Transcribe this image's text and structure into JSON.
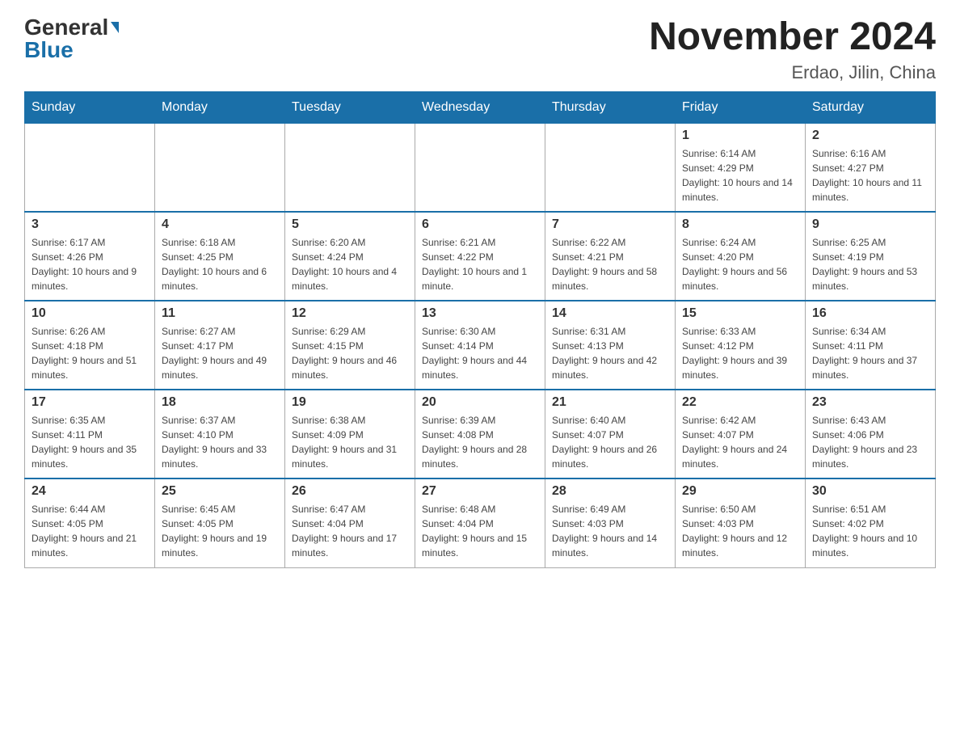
{
  "header": {
    "logo_general": "General",
    "logo_blue": "Blue",
    "month_title": "November 2024",
    "location": "Erdao, Jilin, China"
  },
  "days_of_week": [
    "Sunday",
    "Monday",
    "Tuesday",
    "Wednesday",
    "Thursday",
    "Friday",
    "Saturday"
  ],
  "weeks": [
    [
      {
        "day": "",
        "info": ""
      },
      {
        "day": "",
        "info": ""
      },
      {
        "day": "",
        "info": ""
      },
      {
        "day": "",
        "info": ""
      },
      {
        "day": "",
        "info": ""
      },
      {
        "day": "1",
        "info": "Sunrise: 6:14 AM\nSunset: 4:29 PM\nDaylight: 10 hours and 14 minutes."
      },
      {
        "day": "2",
        "info": "Sunrise: 6:16 AM\nSunset: 4:27 PM\nDaylight: 10 hours and 11 minutes."
      }
    ],
    [
      {
        "day": "3",
        "info": "Sunrise: 6:17 AM\nSunset: 4:26 PM\nDaylight: 10 hours and 9 minutes."
      },
      {
        "day": "4",
        "info": "Sunrise: 6:18 AM\nSunset: 4:25 PM\nDaylight: 10 hours and 6 minutes."
      },
      {
        "day": "5",
        "info": "Sunrise: 6:20 AM\nSunset: 4:24 PM\nDaylight: 10 hours and 4 minutes."
      },
      {
        "day": "6",
        "info": "Sunrise: 6:21 AM\nSunset: 4:22 PM\nDaylight: 10 hours and 1 minute."
      },
      {
        "day": "7",
        "info": "Sunrise: 6:22 AM\nSunset: 4:21 PM\nDaylight: 9 hours and 58 minutes."
      },
      {
        "day": "8",
        "info": "Sunrise: 6:24 AM\nSunset: 4:20 PM\nDaylight: 9 hours and 56 minutes."
      },
      {
        "day": "9",
        "info": "Sunrise: 6:25 AM\nSunset: 4:19 PM\nDaylight: 9 hours and 53 minutes."
      }
    ],
    [
      {
        "day": "10",
        "info": "Sunrise: 6:26 AM\nSunset: 4:18 PM\nDaylight: 9 hours and 51 minutes."
      },
      {
        "day": "11",
        "info": "Sunrise: 6:27 AM\nSunset: 4:17 PM\nDaylight: 9 hours and 49 minutes."
      },
      {
        "day": "12",
        "info": "Sunrise: 6:29 AM\nSunset: 4:15 PM\nDaylight: 9 hours and 46 minutes."
      },
      {
        "day": "13",
        "info": "Sunrise: 6:30 AM\nSunset: 4:14 PM\nDaylight: 9 hours and 44 minutes."
      },
      {
        "day": "14",
        "info": "Sunrise: 6:31 AM\nSunset: 4:13 PM\nDaylight: 9 hours and 42 minutes."
      },
      {
        "day": "15",
        "info": "Sunrise: 6:33 AM\nSunset: 4:12 PM\nDaylight: 9 hours and 39 minutes."
      },
      {
        "day": "16",
        "info": "Sunrise: 6:34 AM\nSunset: 4:11 PM\nDaylight: 9 hours and 37 minutes."
      }
    ],
    [
      {
        "day": "17",
        "info": "Sunrise: 6:35 AM\nSunset: 4:11 PM\nDaylight: 9 hours and 35 minutes."
      },
      {
        "day": "18",
        "info": "Sunrise: 6:37 AM\nSunset: 4:10 PM\nDaylight: 9 hours and 33 minutes."
      },
      {
        "day": "19",
        "info": "Sunrise: 6:38 AM\nSunset: 4:09 PM\nDaylight: 9 hours and 31 minutes."
      },
      {
        "day": "20",
        "info": "Sunrise: 6:39 AM\nSunset: 4:08 PM\nDaylight: 9 hours and 28 minutes."
      },
      {
        "day": "21",
        "info": "Sunrise: 6:40 AM\nSunset: 4:07 PM\nDaylight: 9 hours and 26 minutes."
      },
      {
        "day": "22",
        "info": "Sunrise: 6:42 AM\nSunset: 4:07 PM\nDaylight: 9 hours and 24 minutes."
      },
      {
        "day": "23",
        "info": "Sunrise: 6:43 AM\nSunset: 4:06 PM\nDaylight: 9 hours and 23 minutes."
      }
    ],
    [
      {
        "day": "24",
        "info": "Sunrise: 6:44 AM\nSunset: 4:05 PM\nDaylight: 9 hours and 21 minutes."
      },
      {
        "day": "25",
        "info": "Sunrise: 6:45 AM\nSunset: 4:05 PM\nDaylight: 9 hours and 19 minutes."
      },
      {
        "day": "26",
        "info": "Sunrise: 6:47 AM\nSunset: 4:04 PM\nDaylight: 9 hours and 17 minutes."
      },
      {
        "day": "27",
        "info": "Sunrise: 6:48 AM\nSunset: 4:04 PM\nDaylight: 9 hours and 15 minutes."
      },
      {
        "day": "28",
        "info": "Sunrise: 6:49 AM\nSunset: 4:03 PM\nDaylight: 9 hours and 14 minutes."
      },
      {
        "day": "29",
        "info": "Sunrise: 6:50 AM\nSunset: 4:03 PM\nDaylight: 9 hours and 12 minutes."
      },
      {
        "day": "30",
        "info": "Sunrise: 6:51 AM\nSunset: 4:02 PM\nDaylight: 9 hours and 10 minutes."
      }
    ]
  ]
}
